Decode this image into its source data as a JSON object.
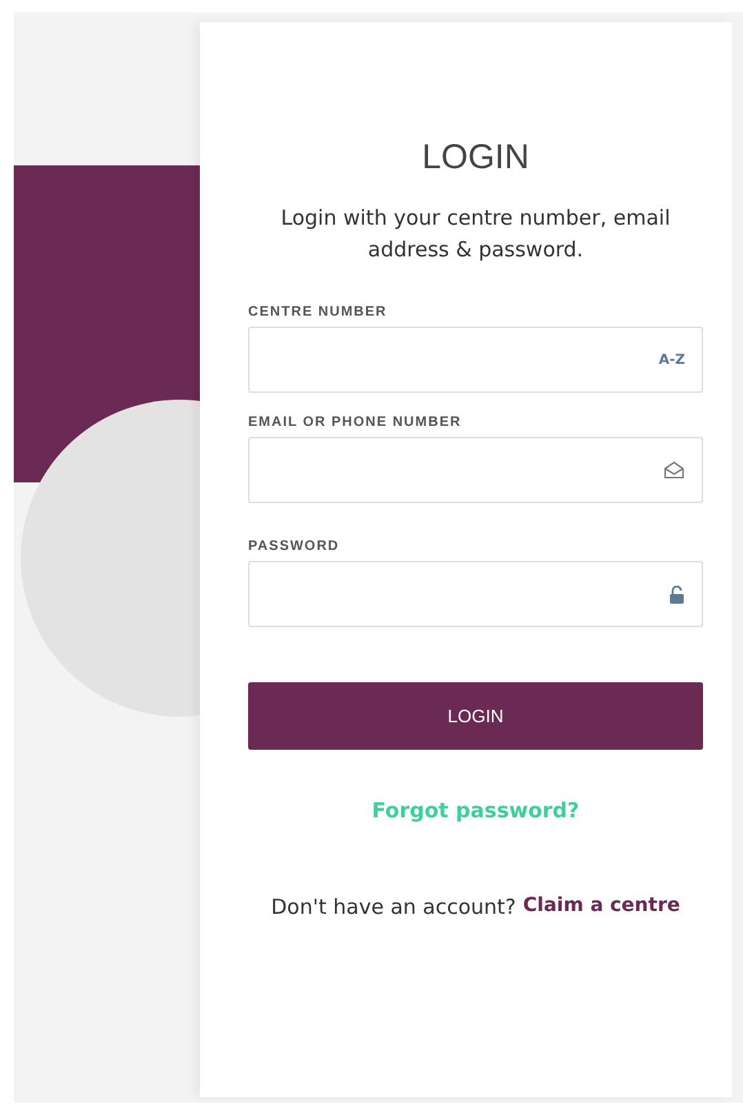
{
  "title": "LOGIN",
  "subtitle": "Login with your centre number, email address & password.",
  "fields": [
    {
      "label": "CENTRE NUMBER",
      "adornment": {
        "kind": "text",
        "text": "A-Z"
      }
    },
    {
      "label": "EMAIL OR PHONE NUMBER",
      "adornment": {
        "kind": "envelope"
      }
    },
    {
      "label": "PASSWORD",
      "adornment": {
        "kind": "lock"
      }
    }
  ],
  "submit": "LOGIN",
  "forgot_link": "Forgot password?",
  "footer": {
    "text": "Don't have an account?",
    "link": "Claim a centre"
  }
}
